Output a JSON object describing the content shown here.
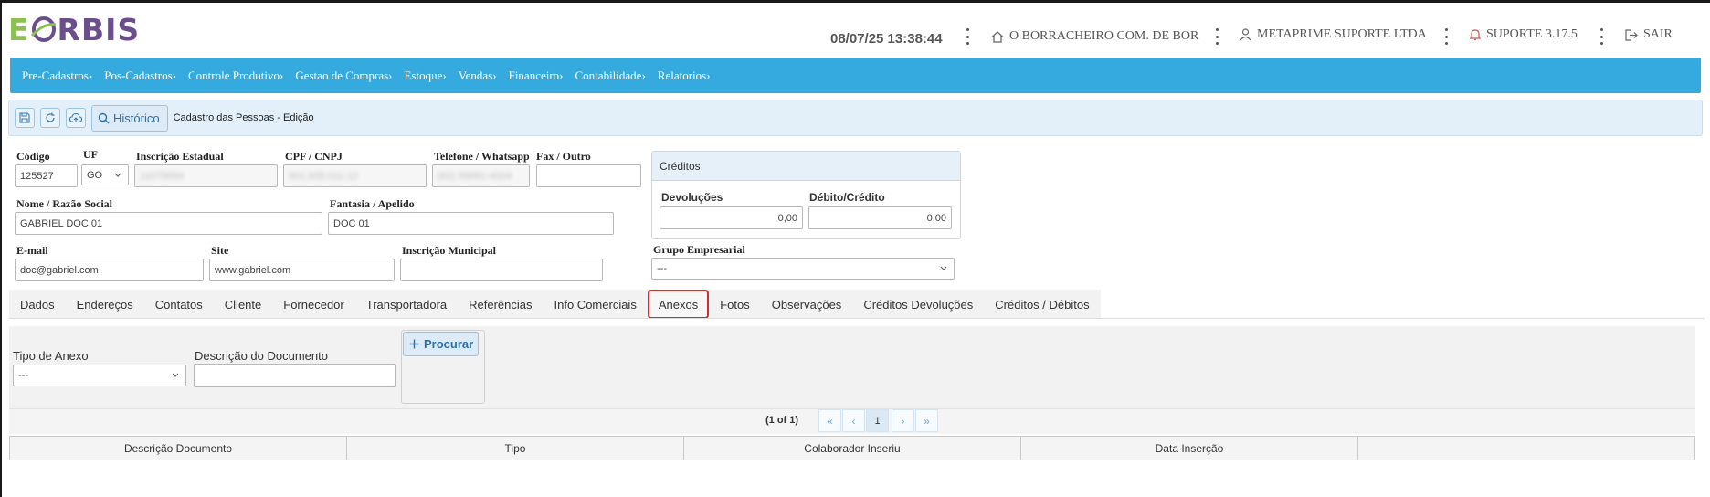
{
  "app": {
    "logo_e": "E",
    "logo_rest": "RBIS"
  },
  "header": {
    "datetime": "08/07/25 13:38:44",
    "company": "O BORRACHEIRO COM. DE BOR",
    "user": "METAPRIME SUPORTE LTDA",
    "support": "SUPORTE 3.17.5",
    "logout": "SAIR",
    "icons": [
      "home-icon",
      "user-icon",
      "bell-icon",
      "logout-icon"
    ]
  },
  "menu": [
    "Pre-Cadastros›",
    "Pos-Cadastros›",
    "Controle Produtivo›",
    "Gestao de Compras›",
    "Estoque›",
    "Vendas›",
    "Financeiro›",
    "Contabilidade›",
    "Relatorios›"
  ],
  "toolbar": {
    "historico_label": "Histórico",
    "title": "Cadastro das Pessoas - Edição"
  },
  "form": {
    "codigo": {
      "label": "Código",
      "value": "125527"
    },
    "uf": {
      "label": "UF",
      "value": "GO"
    },
    "inscricao_estadual": {
      "label": "Inscrição Estadual",
      "value": "11078694"
    },
    "cpf_cnpj": {
      "label": "CPF / CNPJ",
      "value": "001.939.011-12"
    },
    "telefone": {
      "label": "Telefone / Whatsapp",
      "value": "(62) 99891-4324"
    },
    "fax": {
      "label": "Fax / Outro",
      "value": ""
    },
    "nome": {
      "label": "Nome / Razão Social",
      "value": "GABRIEL DOC 01"
    },
    "fantasia": {
      "label": "Fantasia / Apelido",
      "value": "DOC 01"
    },
    "email": {
      "label": "E-mail",
      "value": "doc@gabriel.com"
    },
    "site": {
      "label": "Site",
      "value": "www.gabriel.com"
    },
    "inscricao_municipal": {
      "label": "Inscrição Municipal",
      "value": ""
    },
    "grupo_empresarial": {
      "label": "Grupo Empresarial",
      "value": "---"
    }
  },
  "creditos": {
    "title": "Créditos",
    "devolucoes": {
      "label": "Devoluções",
      "value": "0,00"
    },
    "debito_credito": {
      "label": "Débito/Crédito",
      "value": "0,00"
    }
  },
  "tabs": [
    "Dados",
    "Endereços",
    "Contatos",
    "Cliente",
    "Fornecedor",
    "Transportadora",
    "Referências",
    "Info Comerciais",
    "Anexos",
    "Fotos",
    "Observações",
    "Créditos Devoluções",
    "Créditos / Débitos"
  ],
  "active_tab": "Anexos",
  "anexos": {
    "tipo_label": "Tipo de Anexo",
    "tipo_value": "---",
    "descricao_label": "Descrição do Documento",
    "descricao_value": "",
    "procurar_label": "Procurar"
  },
  "pager": {
    "info": "(1 of 1)",
    "page": "1",
    "first": "«",
    "prev": "‹",
    "next": "›",
    "last": "»"
  },
  "table": {
    "columns": [
      "Descrição Documento",
      "Tipo",
      "Colaborador Inseriu",
      "Data Inserção",
      ""
    ]
  },
  "colors": {
    "menu_bg": "#35aadf",
    "active_tab_border": "#d62b2b",
    "logo_green": "#8cc152",
    "logo_purple": "#6b4e8c"
  }
}
